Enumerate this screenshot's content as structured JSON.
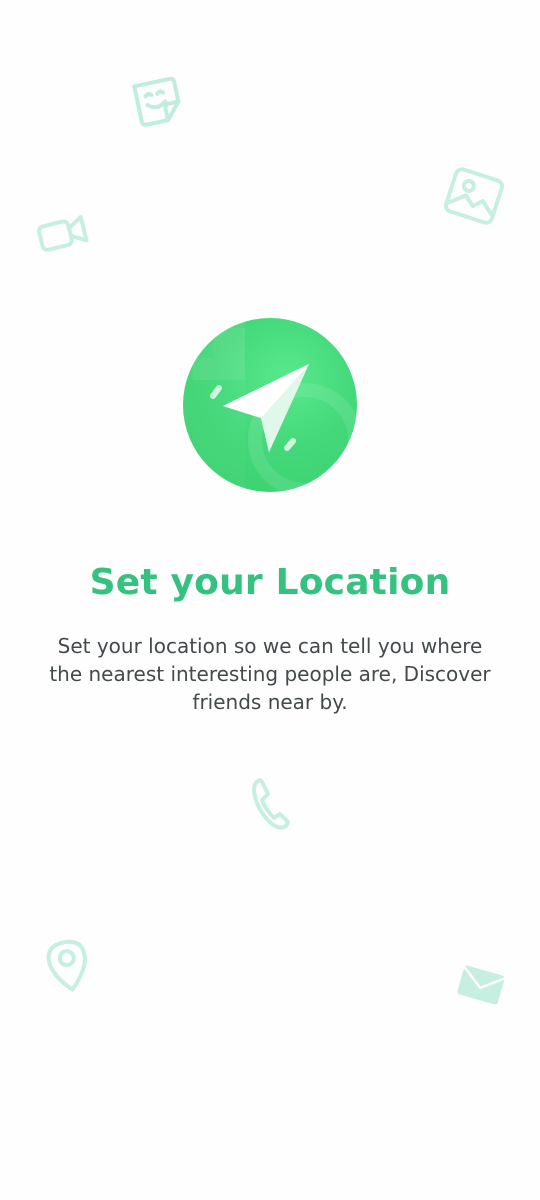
{
  "onboarding": {
    "title": "Set your Location",
    "description": "Set your location so we can tell you where the nearest interesting people are, Discover friends near by."
  },
  "icons": {
    "hero": "navigation-arrow-icon",
    "decorations": [
      "sticker-icon",
      "image-icon",
      "video-camera-icon",
      "phone-icon",
      "location-pin-icon",
      "envelope-icon"
    ]
  },
  "colors": {
    "accent": "#35c180",
    "hero_green": "#44d87a",
    "decor_mint": "#bfeede",
    "body_text": "#444a4c",
    "background": "#fefefe"
  }
}
